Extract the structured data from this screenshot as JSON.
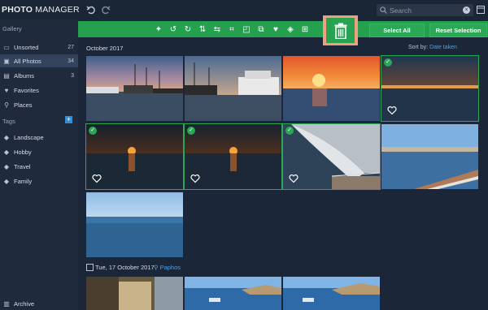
{
  "app": {
    "title_bold": "PHOTO",
    "title_rest": " MANAGER"
  },
  "search": {
    "placeholder": "Search"
  },
  "sidebar": {
    "gallery_heading": "Gallery",
    "items": [
      {
        "label": "Unsorted",
        "count": "27",
        "icon": "unsorted-icon"
      },
      {
        "label": "All Photos",
        "count": "34",
        "icon": "photos-icon"
      },
      {
        "label": "Albums",
        "count": "3",
        "icon": "albums-icon"
      },
      {
        "label": "Favorites",
        "count": "",
        "icon": "heart-icon"
      },
      {
        "label": "Places",
        "count": "",
        "icon": "pin-icon"
      }
    ],
    "tags_heading": "Tags",
    "tags": [
      {
        "label": "Landscape",
        "icon": "tag-icon"
      },
      {
        "label": "Hobby",
        "icon": "tag-icon"
      },
      {
        "label": "Travel",
        "icon": "tag-icon"
      },
      {
        "label": "Family",
        "icon": "tag-icon"
      }
    ],
    "archive": "Archive"
  },
  "toolbar": {
    "select_all": "Select All",
    "reset_selection": "Reset Selection"
  },
  "main": {
    "group1_label": "October 2017",
    "sort_label": "Sort by: ",
    "sort_value": "Date taken",
    "group2_date": "Tue, 17 October 2017",
    "group2_location": "Paphos"
  },
  "colors": {
    "accent_green": "#24a04f",
    "highlight_orange": "#f0a07d",
    "link_blue": "#4aa0e8"
  }
}
